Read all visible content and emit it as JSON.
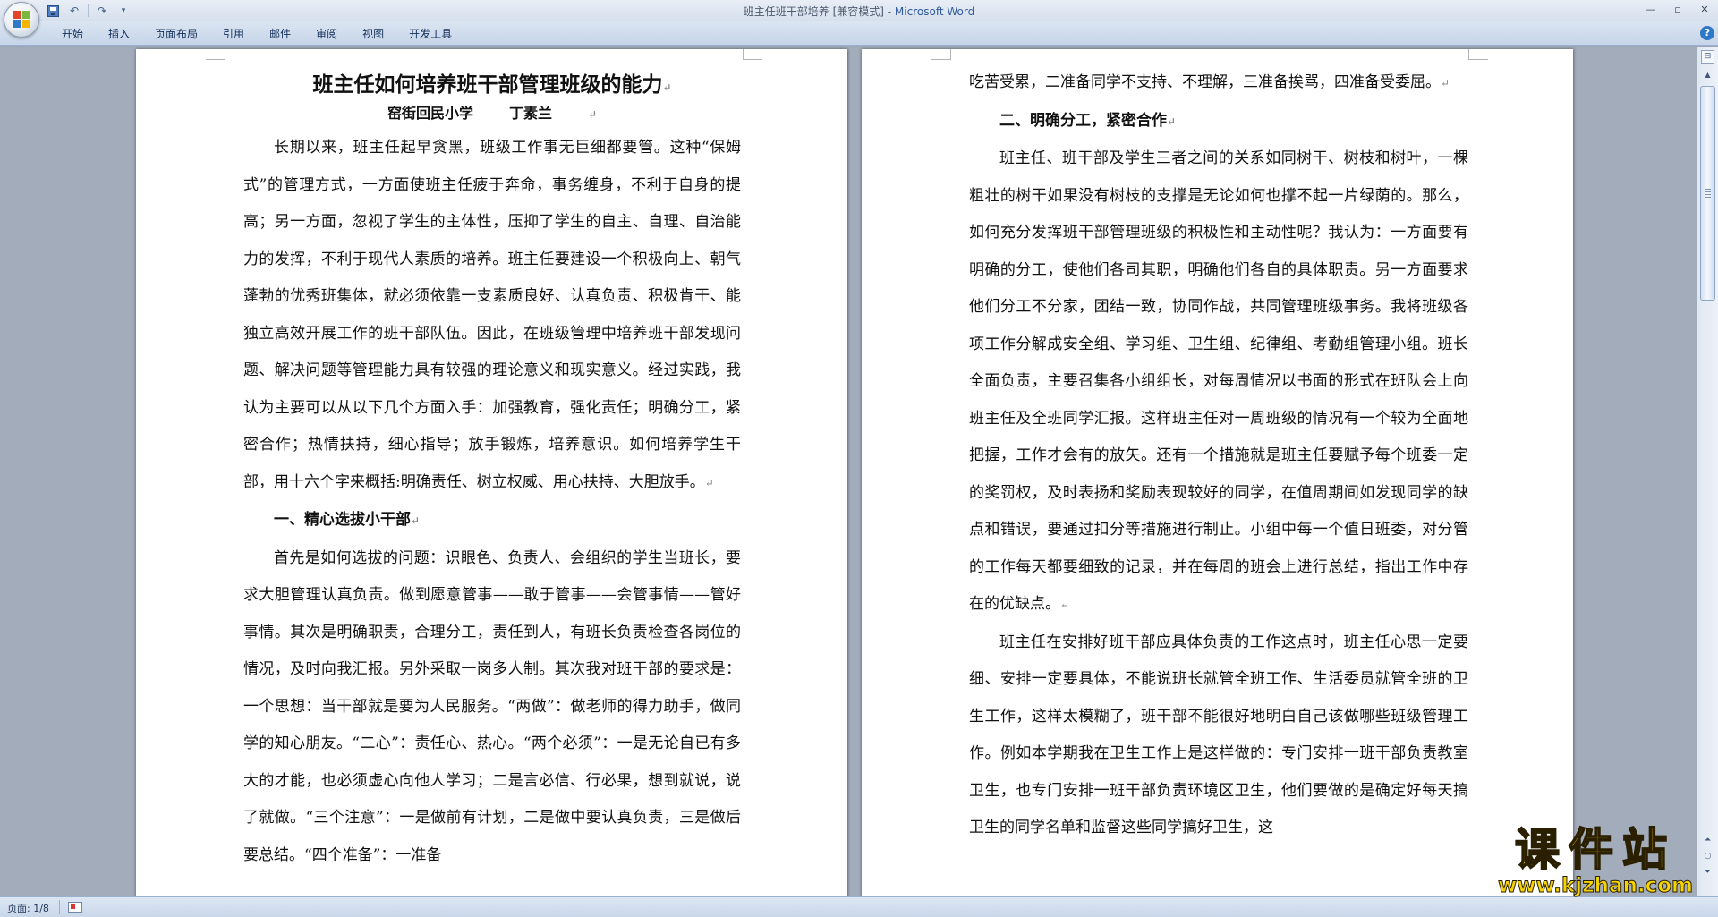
{
  "window": {
    "title": "班主任班干部培养 [兼容模式] - ",
    "app_name": "Microsoft Word",
    "minimize": "—",
    "restore": "▫",
    "close": "✕"
  },
  "qat": {
    "undo": "↶",
    "redo": "↷",
    "dropdown": "▾"
  },
  "ribbon": {
    "tabs": [
      "开始",
      "插入",
      "页面布局",
      "引用",
      "邮件",
      "审阅",
      "视图",
      "开发工具"
    ],
    "help": "?"
  },
  "document": {
    "title": "班主任如何培养班干部管理班级的能力",
    "school": "窑街回民小学",
    "author": "丁素兰",
    "left_paragraphs": [
      "长期以来，班主任起早贪黑，班级工作事无巨细都要管。这种“保姆式”的管理方式，一方面使班主任疲于奔命，事务缠身，不利于自身的提高；另一方面，忽视了学生的主体性，压抑了学生的自主、自理、自治能力的发挥，不利于现代人素质的培养。班主任要建设一个积极向上、朝气蓬勃的优秀班集体，就必须依靠一支素质良好、认真负责、积极肯干、能独立高效开展工作的班干部队伍。因此，在班级管理中培养班干部发现问题、解决问题等管理能力具有较强的理论意义和现实意义。经过实践，我认为主要可以从以下几个方面入手：加强教育，强化责任；明确分工，紧密合作；热情扶持，细心指导；放手锻炼，培养意识。如何培养学生干部，用十六个字来概括:明确责任、树立权威、用心扶持、大胆放手。"
    ],
    "section1_heading": "一、精心选拔小干部",
    "section1_paragraph": "首先是如何选拔的问题：识眼色、负责人、会组织的学生当班长，要求大胆管理认真负责。做到愿意管事——敢于管事——会管事情——管好事情。其次是明确职责，合理分工，责任到人，有班长负责检查各岗位的情况，及时向我汇报。另外采取一岗多人制。其次我对班干部的要求是：一个思想：当干部就是要为人民服务。“两做”：做老师的得力助手，做同学的知心朋友。“二心”：责任心、热心。“两个必须”：一是无论自已有多大的才能，也必须虚心向他人学习；二是言必信、行必果，想到就说，说了就做。“三个注意”：一是做前有计划，二是做中要认真负责，三是做后要总结。“四个准备”：一准备",
    "right_continuation": "吃苦受累，二准备同学不支持、不理解，三准备挨骂，四准备受委屈。",
    "section2_heading": "二、明确分工，紧密合作",
    "section2_paragraph1": "班主任、班干部及学生三者之间的关系如同树干、树枝和树叶，一棵粗壮的树干如果没有树枝的支撑是无论如何也撑不起一片绿荫的。那么，如何充分发挥班干部管理班级的积极性和主动性呢？我认为：一方面要有明确的分工，使他们各司其职，明确他们各自的具体职责。另一方面要求他们分工不分家，团结一致，协同作战，共同管理班级事务。我将班级各项工作分解成安全组、学习组、卫生组、纪律组、考勤组管理小组。班长全面负责，主要召集各小组组长，对每周情况以书面的形式在班队会上向班主任及全班同学汇报。这样班主任对一周班级的情况有一个较为全面地把握，工作才会有的放矢。还有一个措施就是班主任要赋予每个班委一定的奖罚权，及时表扬和奖励表现较好的同学，在值周期间如发现同学的缺点和错误，要通过扣分等措施进行制止。小组中每一个值日班委，对分管的工作每天都要细致的记录，并在每周的班会上进行总结，指出工作中存在的优缺点。",
    "section2_paragraph2": "班主任在安排好班干部应具体负责的工作这点时，班主任心思一定要细、安排一定要具体，不能说班长就管全班工作、生活委员就管全班的卫生工作，这样太模糊了，班干部不能很好地明白自己该做哪些班级管理工作。例如本学期我在卫生工作上是这样做的：专门安排一班干部负责教室卫生，也专门安排一班干部负责环境区卫生，他们要做的是确定好每天搞卫生的同学名单和监督这些同学搞好卫生，这",
    "paragraph_mark": "↵"
  },
  "status": {
    "page": "页面: 1/8"
  },
  "scrollbar": {
    "up": "▲",
    "prev": "⏶",
    "select": "○",
    "next": "⏷",
    "ruler": "⊟"
  },
  "watermark": {
    "text": "课件站",
    "url": "www.kjzhan.com"
  }
}
